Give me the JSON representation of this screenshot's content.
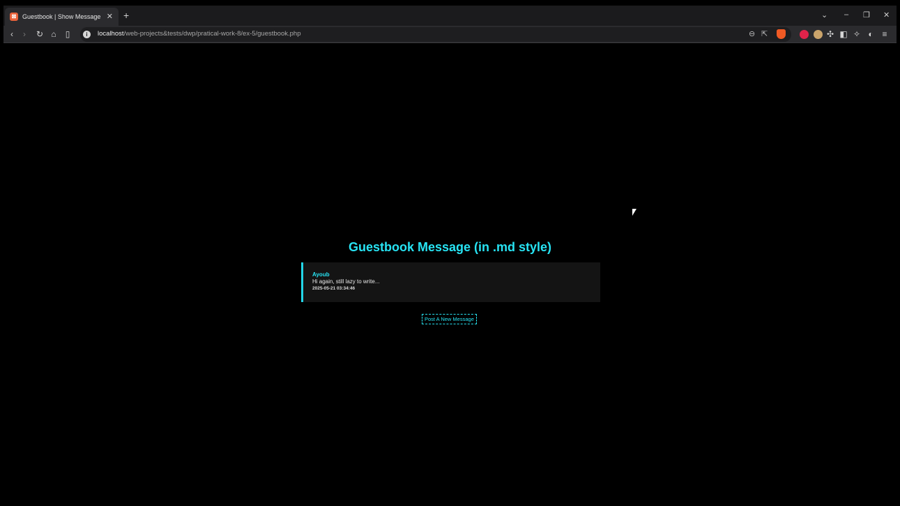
{
  "browser": {
    "tab": {
      "favicon": "xampp-logo",
      "title": "Guestbook | Show Message"
    },
    "url": {
      "host": "localhost",
      "path": "/web-projects&tests/dwp/pratical-work-8/ex-5/guestbook.php"
    },
    "colors": {
      "brave_orange": "#f05a24",
      "accent_cyan": "#27e3f3"
    }
  },
  "page": {
    "heading": "Guestbook Message (in .md style)",
    "message": {
      "author": "Ayoub",
      "text": "Hi again, still lazy to write...",
      "date": "2025-05-21 03:34:46"
    },
    "post_link": "Post A New Message"
  }
}
